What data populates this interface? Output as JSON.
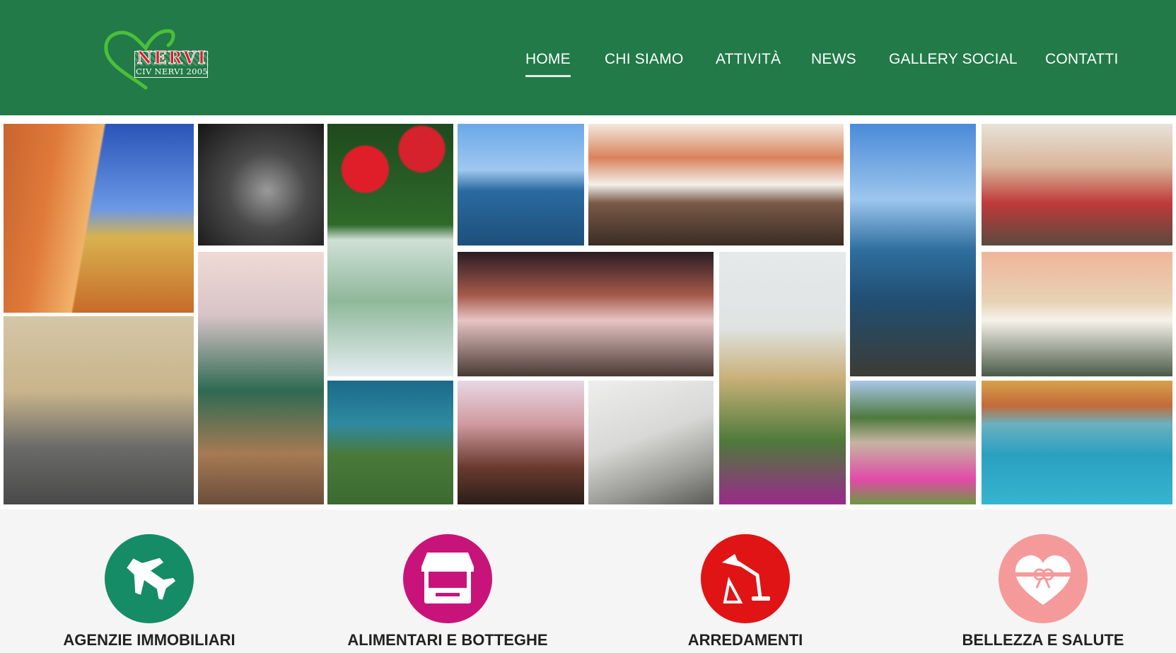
{
  "header": {
    "logo": {
      "word": "NERVI",
      "subtitle": "CIV NERVI 2005",
      "heart_color": "#4cbf3a"
    },
    "nav": [
      {
        "label": "HOME",
        "active": true
      },
      {
        "label": "CHI SIAMO",
        "active": false
      },
      {
        "label": "ATTIVITÀ",
        "active": false
      },
      {
        "label": "NEWS",
        "active": false
      },
      {
        "label": "GALLERY SOCIAL",
        "active": false
      },
      {
        "label": "CONTATTI",
        "active": false
      }
    ],
    "background_color": "#217a47"
  },
  "gallery": {
    "photos": [
      {
        "name": "photo-orange-buildings-street"
      },
      {
        "name": "photo-singer-black-white"
      },
      {
        "name": "photo-red-flowers-map"
      },
      {
        "name": "photo-tower-seaside"
      },
      {
        "name": "photo-crowded-piazza"
      },
      {
        "name": "photo-rocky-coast"
      },
      {
        "name": "photo-street-performers-stilts"
      },
      {
        "name": "photo-narrow-street-road"
      },
      {
        "name": "photo-table-decoration-candles"
      },
      {
        "name": "photo-night-crowd-street"
      },
      {
        "name": "photo-bell-tower"
      },
      {
        "name": "photo-outdoor-cafe-tables"
      },
      {
        "name": "photo-aerial-coast-cliffs"
      },
      {
        "name": "photo-stilt-performer-night"
      },
      {
        "name": "photo-railing-flowers"
      },
      {
        "name": "photo-rose-garden-hills"
      },
      {
        "name": "photo-harbour-colored-houses"
      }
    ]
  },
  "categories": [
    {
      "label": "AGENZIE IMMOBILIARI",
      "icon": "airplane-icon",
      "color": "#158c65"
    },
    {
      "label": "ALIMENTARI E BOTTEGHE",
      "icon": "market-stall-icon",
      "color": "#c8147a"
    },
    {
      "label": "ARREDAMENTI",
      "icon": "desk-lamp-icon",
      "color": "#e01414"
    },
    {
      "label": "BELLEZZA E SALUTE",
      "icon": "gift-heart-icon",
      "color": "#f59a9a"
    }
  ]
}
